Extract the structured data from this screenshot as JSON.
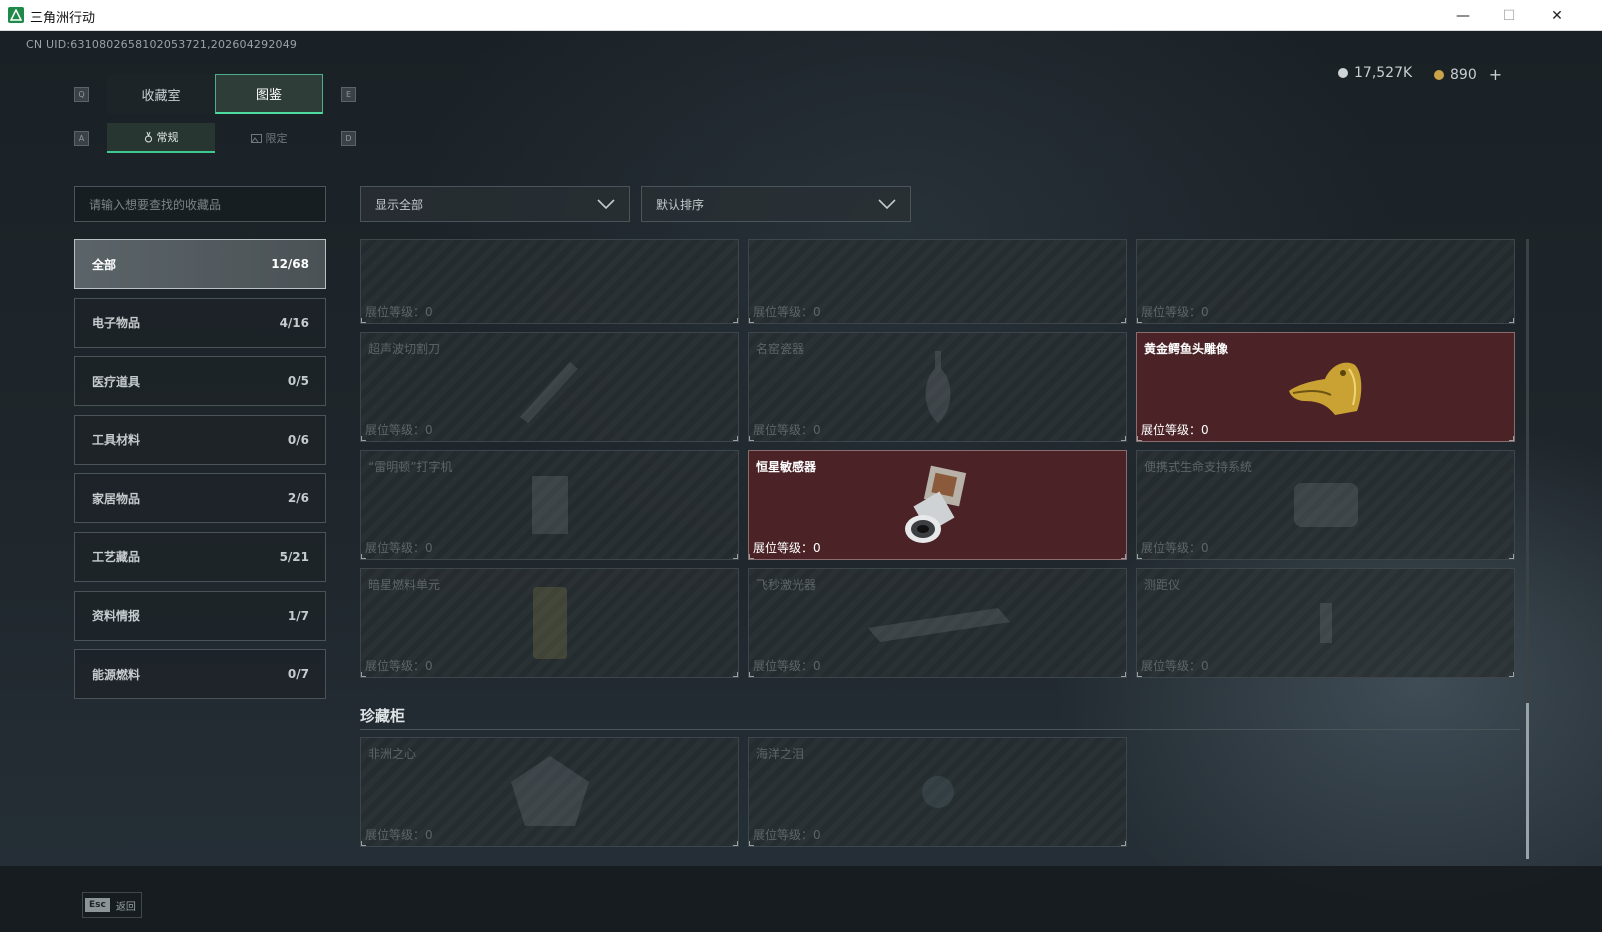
{
  "window": {
    "title": "三角洲行动",
    "minimize": "—",
    "maximize": "☐",
    "close": "✕"
  },
  "uid": "CN UID:6310802658102053721,202604292049",
  "currency": {
    "silver": "17,527K",
    "gold": "890",
    "add": "+"
  },
  "keys": {
    "tab_prev": "Q",
    "tab_next": "E",
    "sub_prev": "A",
    "sub_next": "D"
  },
  "tabs": [
    {
      "label": "收藏室"
    },
    {
      "label": "图鉴"
    }
  ],
  "subtabs": [
    {
      "label": "常规",
      "icon": "medal-icon"
    },
    {
      "label": "限定",
      "icon": "image-icon"
    }
  ],
  "search": {
    "placeholder": "请输入想要查找的收藏品"
  },
  "filters": {
    "display": "显示全部",
    "sort": "默认排序"
  },
  "categories": [
    {
      "label": "全部",
      "count": "12/68"
    },
    {
      "label": "电子物品",
      "count": "4/16"
    },
    {
      "label": "医疗道具",
      "count": "0/5"
    },
    {
      "label": "工具材料",
      "count": "0/6"
    },
    {
      "label": "家居物品",
      "count": "2/6"
    },
    {
      "label": "工艺藏品",
      "count": "5/21"
    },
    {
      "label": "资料情报",
      "count": "1/7"
    },
    {
      "label": "能源燃料",
      "count": "0/7"
    }
  ],
  "level_label": "展位等级：",
  "items": [
    {
      "name": "",
      "level": "0",
      "owned": false
    },
    {
      "name": "",
      "level": "0",
      "owned": false
    },
    {
      "name": "",
      "level": "0",
      "owned": false
    },
    {
      "name": "超声波切割刀",
      "level": "0",
      "owned": false
    },
    {
      "name": "名窑瓷器",
      "level": "0",
      "owned": false
    },
    {
      "name": "黄金鳄鱼头雕像",
      "level": "0",
      "owned": true
    },
    {
      "name": "“雷明顿”打字机",
      "level": "0",
      "owned": false
    },
    {
      "name": "恒星敏感器",
      "level": "0",
      "owned": true
    },
    {
      "name": "便携式生命支持系统",
      "level": "0",
      "owned": false
    },
    {
      "name": "暗星燃料单元",
      "level": "0",
      "owned": false
    },
    {
      "name": "飞秒激光器",
      "level": "0",
      "owned": false
    },
    {
      "name": "测距仪",
      "level": "0",
      "owned": false
    }
  ],
  "cabinet": {
    "title": "珍藏柜",
    "items": [
      {
        "name": "非洲之心",
        "level": "0",
        "owned": false
      },
      {
        "name": "海洋之泪",
        "level": "0",
        "owned": false
      }
    ]
  },
  "footer": {
    "esc_key": "Esc",
    "back_label": "返回"
  },
  "colors": {
    "accent": "#4fdca0",
    "owned_card": "#4b2327",
    "background": "#1d2429"
  }
}
